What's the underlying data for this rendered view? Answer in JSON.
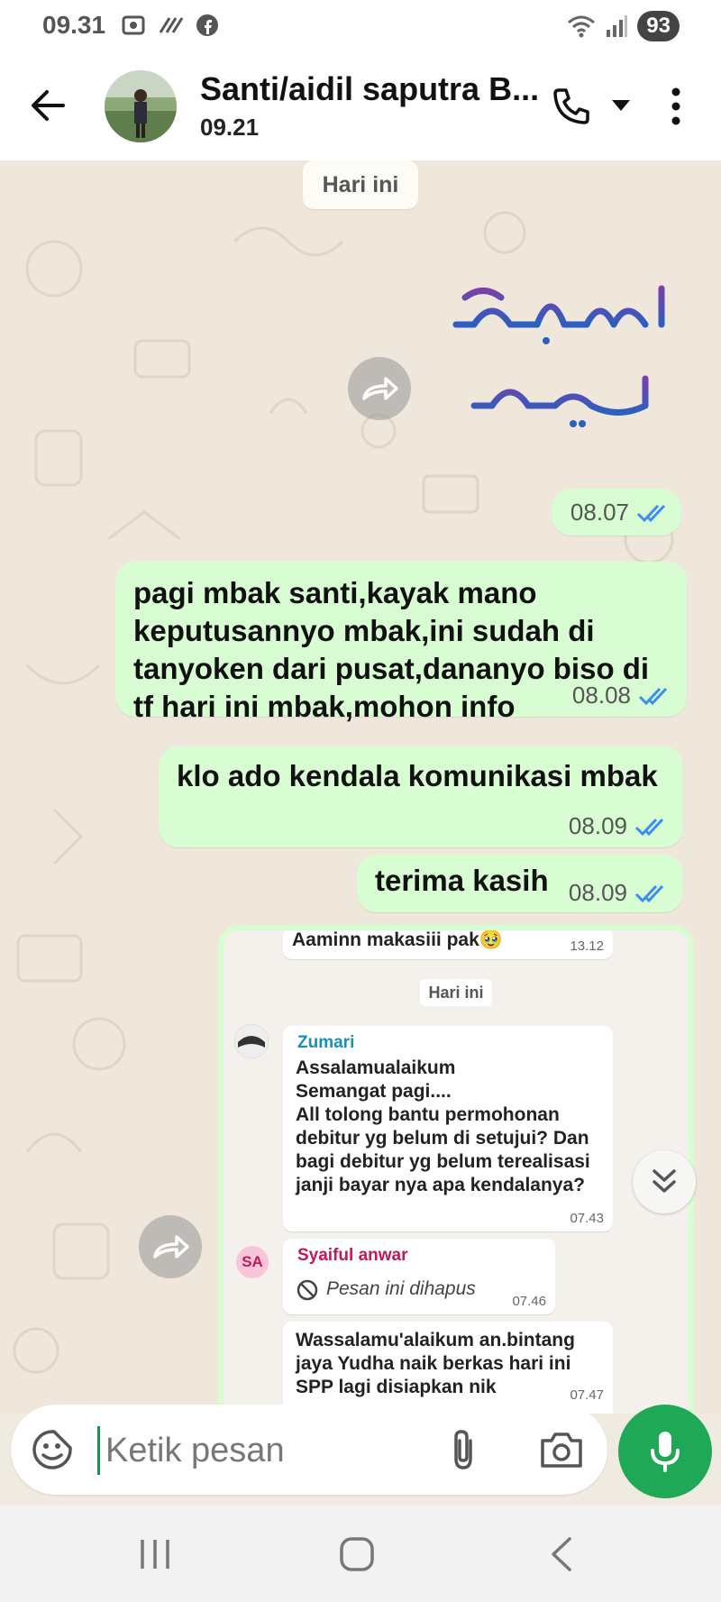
{
  "status_bar": {
    "time": "09.31",
    "battery": "93"
  },
  "header": {
    "contact_name": "Santi/aidil saputra B...",
    "last_seen": "09.21"
  },
  "date_chip": "Hari ini",
  "messages": [
    {
      "text": "",
      "time": "08.07"
    },
    {
      "lines": [
        "pagi mbak santi,kayak mano",
        "keputusannyo mbak,ini sudah di",
        "tanyoken dari pusat,dananyo biso di",
        "tf hari ini mbak,mohon info"
      ],
      "time": "08.08"
    },
    {
      "text": "klo ado kendala komunikasi mbak",
      "time": "08.09"
    },
    {
      "text": "terima kasih",
      "time": "08.09"
    }
  ],
  "forwarded_image": {
    "top_message": {
      "text": "Aaminn makasiii pak🥹",
      "time": "13.12"
    },
    "date_chip": "Hari ini",
    "zumari": {
      "sender": "Zumari",
      "lines": [
        "Assalamualaikum",
        "Semangat pagi....",
        "All tolong bantu permohonan",
        "debitur yg belum di setujui? Dan",
        "bagi debitur yg belum terealisasi",
        "janji bayar nya apa kendalanya?"
      ],
      "time": "07.43"
    },
    "syaiful": {
      "avatar_initials": "SA",
      "sender": "Syaiful anwar",
      "deleted_text": "Pesan ini dihapus",
      "time": "07.46"
    },
    "last": {
      "lines": [
        "Wassalamu'alaikum an.bintang",
        "jaya Yudha naik berkas hari ini",
        "SPP lagi disiapkan nik"
      ],
      "time": "07.47"
    }
  },
  "composer": {
    "placeholder": "Ketik pesan"
  },
  "colors": {
    "bubble_out": "#d9fdd3",
    "tick_blue": "#3b8ef0",
    "accent_green": "#1fa855"
  }
}
